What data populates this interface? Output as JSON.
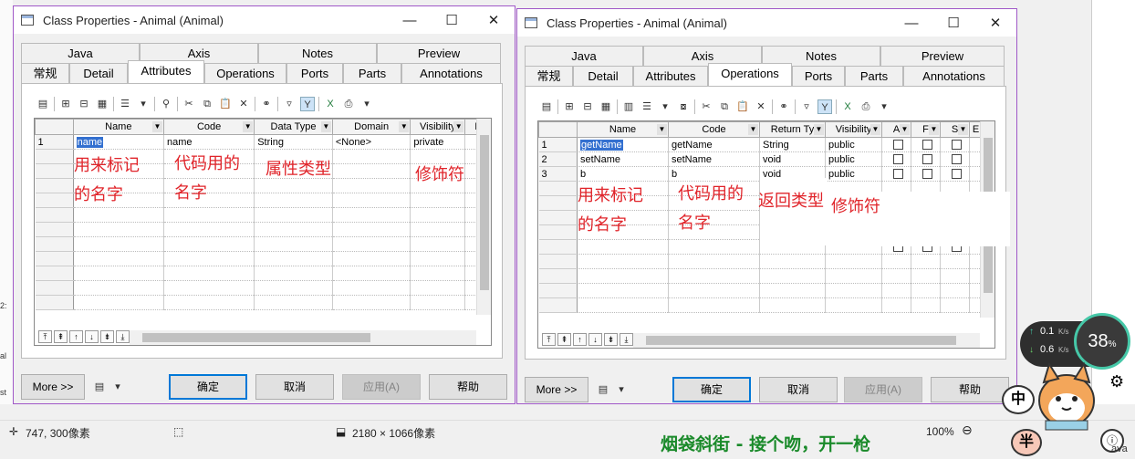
{
  "background": {
    "frag1": "2:",
    "frag2": "al",
    "frag3": "st"
  },
  "dialog_left": {
    "title": "Class Properties - Animal (Animal)",
    "tabs_top": [
      "Java",
      "Axis",
      "Notes",
      "Preview"
    ],
    "tabs_bottom": [
      "常规",
      "Detail",
      "Attributes",
      "Operations",
      "Ports",
      "Parts",
      "Annotations"
    ],
    "active_tab": "Attributes",
    "columns": [
      "Name",
      "Code",
      "Data Type",
      "Domain",
      "Visibility",
      "Ir"
    ],
    "rows": [
      {
        "num": "1",
        "name": "name",
        "code": "name",
        "type": "String",
        "domain": "<None>",
        "visibility": "private"
      }
    ],
    "notes": {
      "name_line1": "用来标记",
      "name_line2": "的名字",
      "code_line1": "代码用的",
      "code_line2": "名字",
      "type": "属性类型",
      "visibility": "修饰符"
    },
    "buttons": {
      "more": "More >>",
      "ok": "确定",
      "cancel": "取消",
      "apply": "应用(A)",
      "help": "帮助"
    }
  },
  "dialog_right": {
    "title": "Class Properties - Animal (Animal)",
    "tabs_top": [
      "Java",
      "Axis",
      "Notes",
      "Preview"
    ],
    "tabs_bottom": [
      "常规",
      "Detail",
      "Attributes",
      "Operations",
      "Ports",
      "Parts",
      "Annotations"
    ],
    "active_tab": "Operations",
    "columns": [
      "Name",
      "Code",
      "Return Ty",
      "Visibility",
      "A",
      "F",
      "S",
      "E"
    ],
    "rows": [
      {
        "num": "1",
        "name": "getName",
        "code": "getName",
        "type": "String",
        "visibility": "public"
      },
      {
        "num": "2",
        "name": "setName",
        "code": "setName",
        "type": "void",
        "visibility": "public"
      },
      {
        "num": "3",
        "name": "b",
        "code": "b",
        "type": "void",
        "visibility": "public"
      }
    ],
    "notes": {
      "name_line1": "用来标记",
      "name_line2": "的名字",
      "code_line1": "代码用的",
      "code_line2": "名字",
      "type": "返回类型",
      "visibility": "修饰符"
    },
    "buttons": {
      "more": "More >>",
      "ok": "确定",
      "cancel": "取消",
      "apply": "应用(A)",
      "help": "帮助"
    }
  },
  "statusbar": {
    "cursor": "747, 300像素",
    "image_size": "2180 × 1066像素",
    "zoom": "100%"
  },
  "overlay": {
    "caption": "烟袋斜街 - 接个吻，开一枪",
    "up_speed": "0.1",
    "down_speed": "0.6",
    "speed_unit": "K/s",
    "gauge": "38",
    "gauge_unit": "%",
    "ime_1": "中",
    "ime_2": "半",
    "corner": "ava"
  },
  "colors": {
    "note": "#e0242a",
    "window_border": "#a058c8",
    "selection": "#3370d0",
    "caption": "#1a8a2a"
  }
}
